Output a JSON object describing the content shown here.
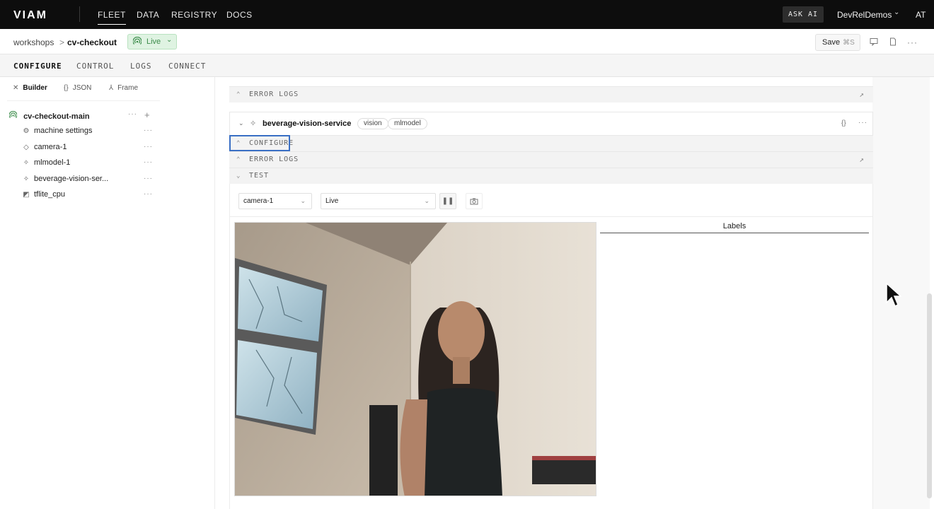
{
  "brand": {
    "logo_text": "VIAM"
  },
  "topnav": {
    "items": [
      {
        "label": "FLEET",
        "active": true
      },
      {
        "label": "DATA",
        "active": false
      },
      {
        "label": "REGISTRY",
        "active": false
      },
      {
        "label": "DOCS",
        "active": false
      }
    ],
    "ask_ai": "ASK AI",
    "org": "DevRelDemos",
    "user_initials": "AT"
  },
  "subbar": {
    "crumb_parent": "workshops",
    "crumb_separator": ">",
    "crumb_current": "cv-checkout",
    "status": "Live",
    "save_label": "Save",
    "save_shortcut": "⌘S"
  },
  "tabs": [
    "CONFIGURE",
    "CONTROL",
    "LOGS",
    "CONNECT"
  ],
  "active_tab": "CONFIGURE",
  "sidebar": {
    "modes": [
      {
        "label": "Builder",
        "icon": "wrench-icon",
        "active": true
      },
      {
        "label": "JSON",
        "icon": "braces-icon",
        "active": false
      },
      {
        "label": "Frame",
        "icon": "frame-icon",
        "active": false
      }
    ],
    "root": {
      "label": "cv-checkout-main",
      "icon": "live-signal-icon"
    },
    "items": [
      {
        "label": "machine settings",
        "icon": "gear-icon"
      },
      {
        "label": "camera-1",
        "icon": "diamond-icon"
      },
      {
        "label": "mlmodel-1",
        "icon": "sparkle-icon"
      },
      {
        "label": "beverage-vision-ser...",
        "icon": "sparkle-icon"
      },
      {
        "label": "tflite_cpu",
        "icon": "module-icon"
      }
    ]
  },
  "main": {
    "top_error_logs": "ERROR LOGS",
    "service": {
      "name": "beverage-vision-service",
      "tags": [
        "vision",
        "mlmodel"
      ],
      "sections": [
        "CONFIGURE",
        "ERROR LOGS",
        "TEST"
      ]
    },
    "test": {
      "camera_select": "camera-1",
      "mode_select": "Live",
      "labels_header": "Labels"
    }
  },
  "colors": {
    "topbar_bg": "#0d0d0d",
    "live_green": "#3b8c4a",
    "focus_blue": "#3a6fc4"
  }
}
